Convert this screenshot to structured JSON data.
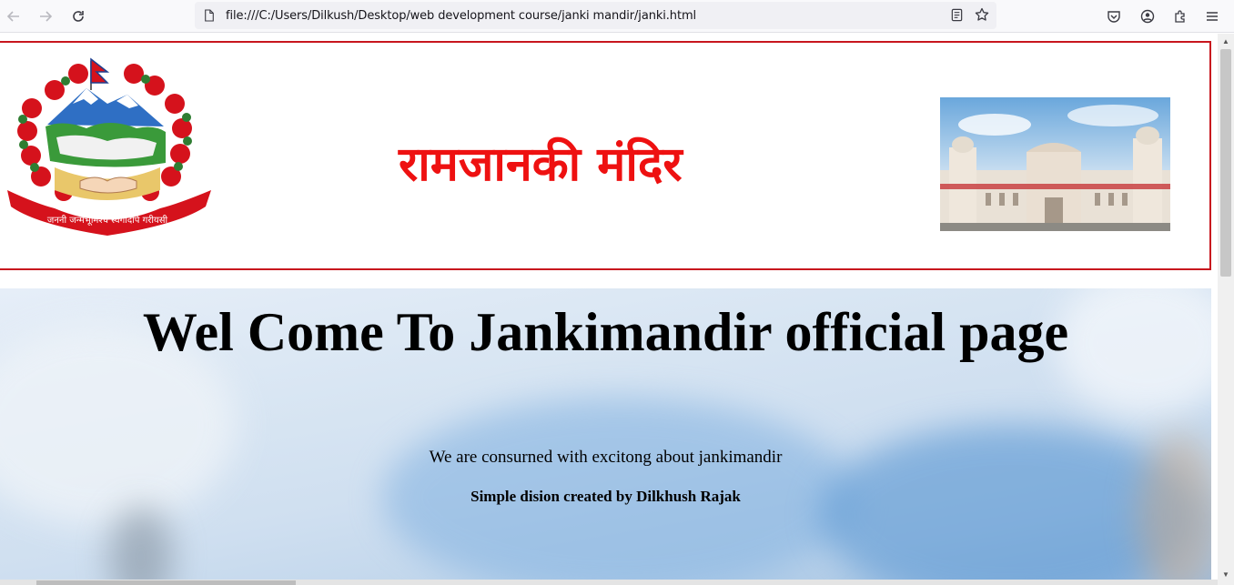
{
  "browser": {
    "url": "file:///C:/Users/Dilkush/Desktop/web development course/janki mandir/janki.html"
  },
  "header": {
    "title_hindi": "रामजानकी मंदिर",
    "emblem_motto": "जननी जन्मभूमिश्च स्वर्गादपि गरीयसी"
  },
  "hero": {
    "heading": "Wel Come To Jankimandir official page",
    "text": "We are consurned with excitong about jankimandir",
    "credit": "Simple dision created by Dilkhush Rajak"
  },
  "colors": {
    "header_border": "#c8161e",
    "title": "#ee1111"
  }
}
